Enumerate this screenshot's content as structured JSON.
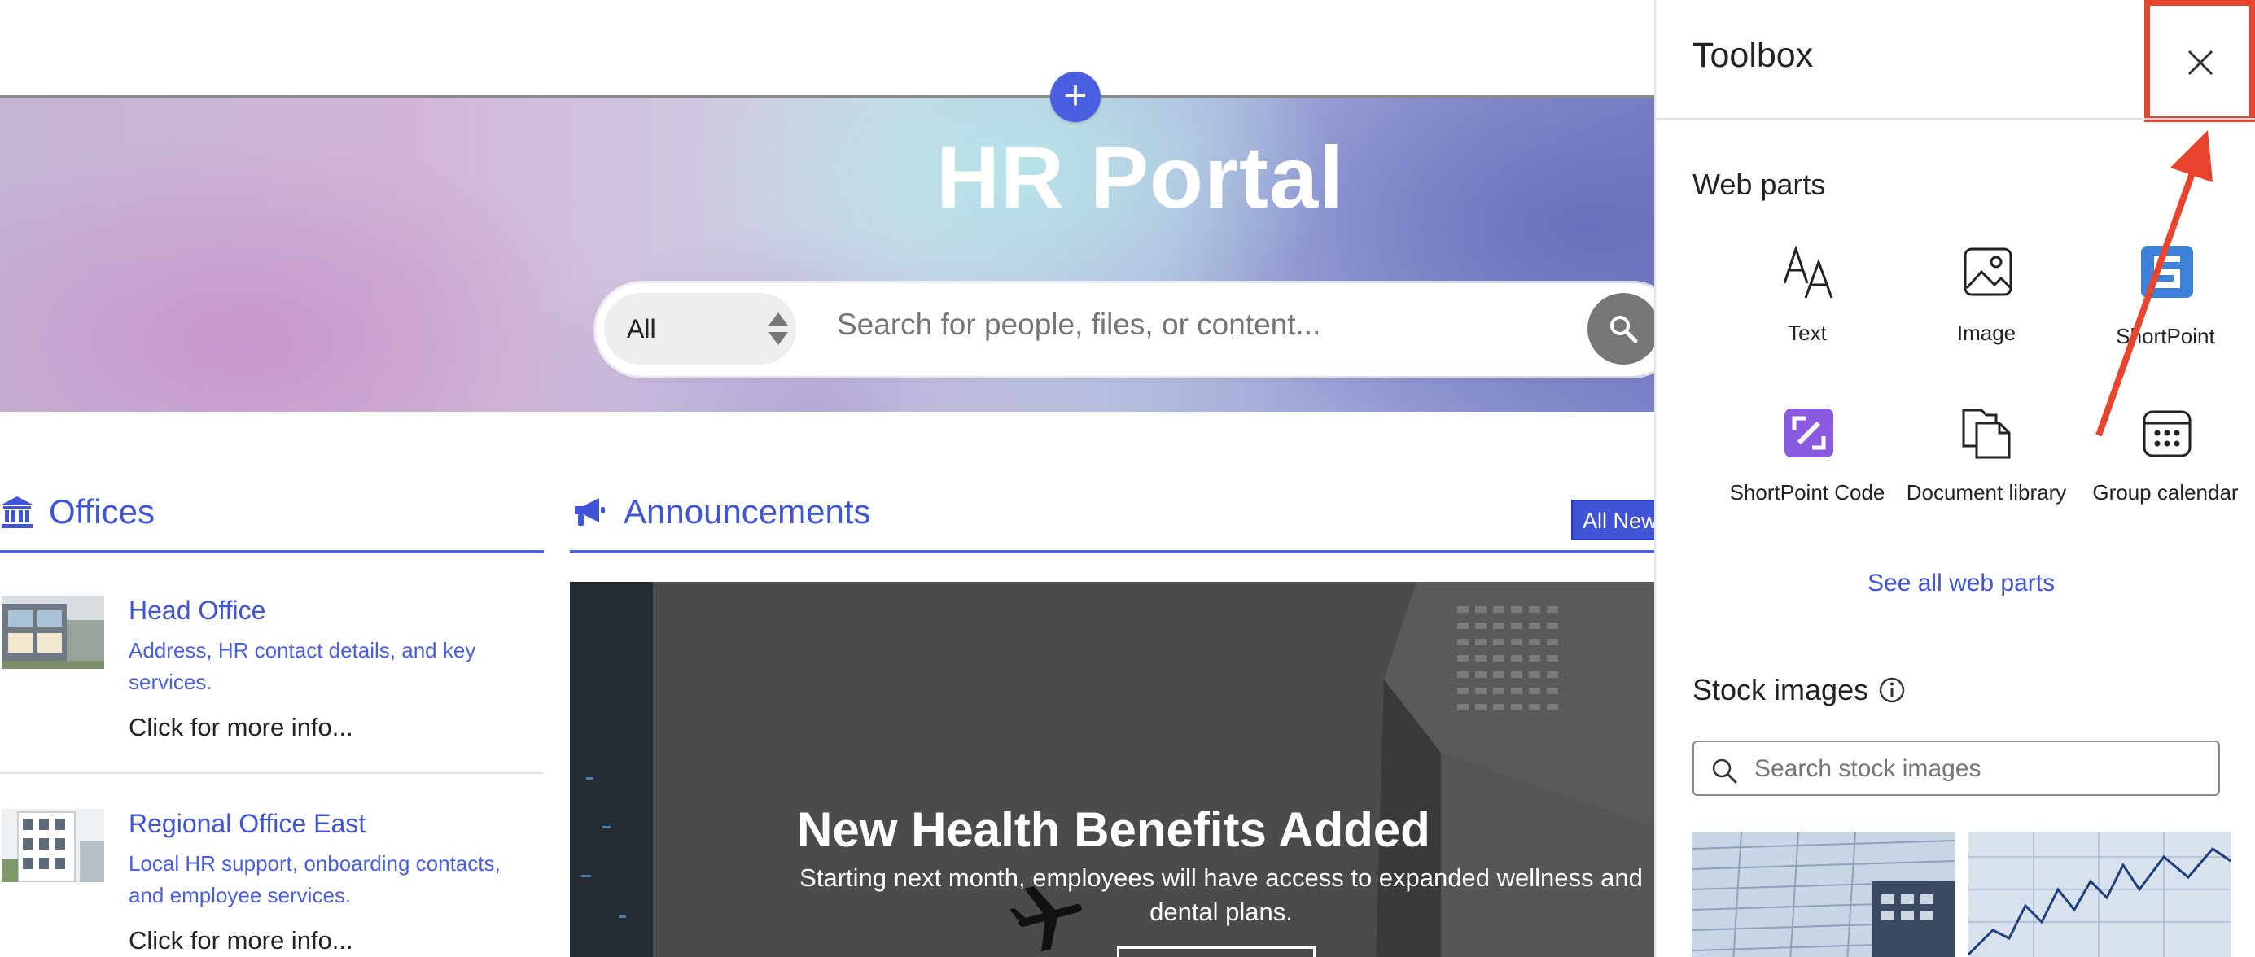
{
  "hero": {
    "title": "HR Portal",
    "search": {
      "scope_value": "All",
      "placeholder": "Search for people, files, or content..."
    }
  },
  "offices": {
    "title": "Offices",
    "items": [
      {
        "name": "Head Office",
        "description": "Address, HR contact details, and key services.",
        "more": "Click for more info..."
      },
      {
        "name": "Regional Office East",
        "description": "Local HR support, onboarding contacts, and employee services.",
        "more": "Click for more info..."
      }
    ]
  },
  "announcements": {
    "title": "Announcements",
    "all_news_label": "All News",
    "featured": {
      "title": "New Health Benefits Added",
      "subtitle": "Starting next month, employees will have access to expanded wellness and dental plans."
    }
  },
  "toolbox": {
    "title": "Toolbox",
    "web_parts_heading": "Web parts",
    "web_parts": [
      {
        "label": "Text",
        "icon": "text-icon"
      },
      {
        "label": "Image",
        "icon": "image-icon"
      },
      {
        "label": "ShortPoint",
        "icon": "shortpoint-icon"
      },
      {
        "label": "ShortPoint Code",
        "icon": "shortpoint-code-icon"
      },
      {
        "label": "Document library",
        "icon": "document-library-icon"
      },
      {
        "label": "Group calendar",
        "icon": "group-calendar-icon"
      }
    ],
    "see_all_label": "See all web parts",
    "stock_images_heading": "Stock images",
    "stock_search_placeholder": "Search stock images"
  },
  "colors": {
    "accent": "#3f54d6",
    "highlight": "#e8442e",
    "shortpoint_blue": "#3b82d8",
    "shortpoint_purple": "#8a5be0"
  }
}
